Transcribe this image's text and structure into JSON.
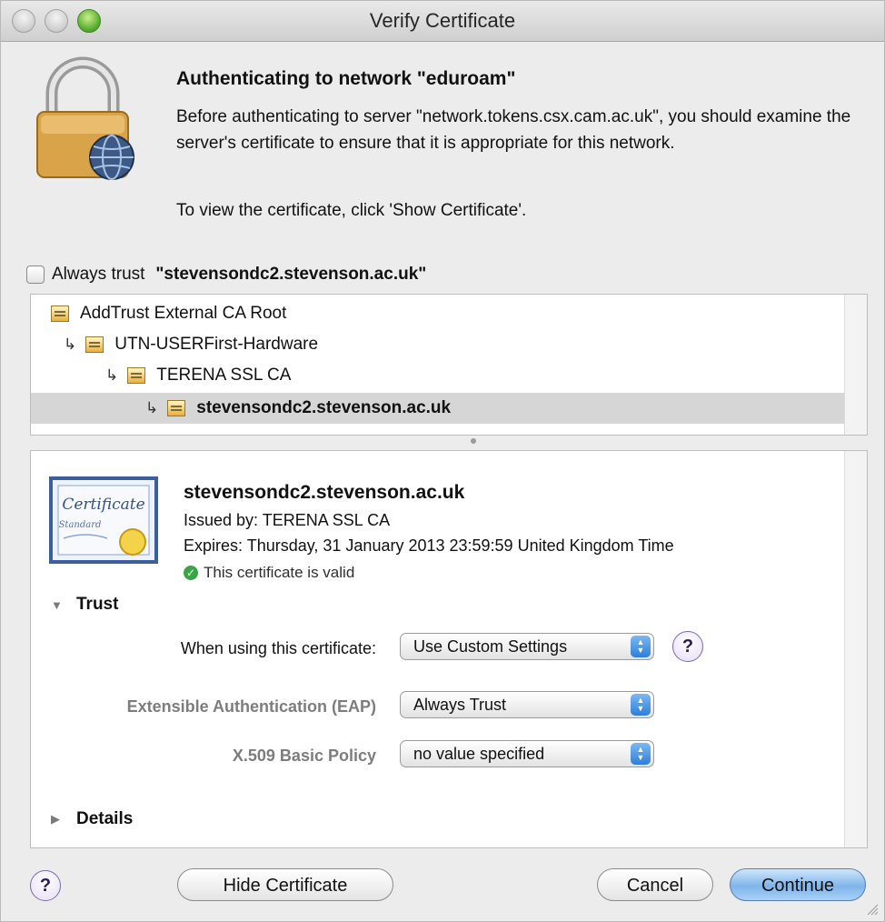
{
  "window": {
    "title": "Verify Certificate"
  },
  "header": {
    "heading": "Authenticating to network \"eduroam\"",
    "description": "Before authenticating to server \"network.tokens.csx.cam.ac.uk\", you should examine the server's certificate to ensure that it is appropriate for this network.",
    "hint": "To view the certificate, click 'Show Certificate'."
  },
  "always_trust": {
    "label": "Always trust",
    "domain": "\"stevensondc2.stevenson.ac.uk\"",
    "checked": false
  },
  "chain": [
    {
      "label": "AddTrust External CA Root",
      "level": 0,
      "selected": false
    },
    {
      "label": "UTN-USERFirst-Hardware",
      "level": 1,
      "selected": false
    },
    {
      "label": "TERENA SSL CA",
      "level": 2,
      "selected": false
    },
    {
      "label": "stevensondc2.stevenson.ac.uk",
      "level": 3,
      "selected": true
    }
  ],
  "certificate": {
    "name": "stevensondc2.stevenson.ac.uk",
    "issued_by": "Issued by: TERENA SSL CA",
    "expires": "Expires: Thursday, 31 January 2013 23:59:59 United Kingdom Time",
    "status": "This certificate is valid",
    "image_text_1": "Certificate",
    "image_text_2": "Standard"
  },
  "trust": {
    "section_label": "Trust",
    "when_using_label": "When using this certificate:",
    "when_using_value": "Use Custom Settings",
    "eap_label": "Extensible Authentication (EAP)",
    "eap_value": "Always Trust",
    "x509_label": "X.509 Basic Policy",
    "x509_value": "no value specified"
  },
  "details": {
    "section_label": "Details"
  },
  "buttons": {
    "help": "?",
    "hide_certificate": "Hide Certificate",
    "cancel": "Cancel",
    "continue": "Continue"
  },
  "colors": {
    "accent_blue": "#7fb5ea",
    "valid_green": "#3aa546",
    "selection_gray": "#d6d6d6"
  }
}
